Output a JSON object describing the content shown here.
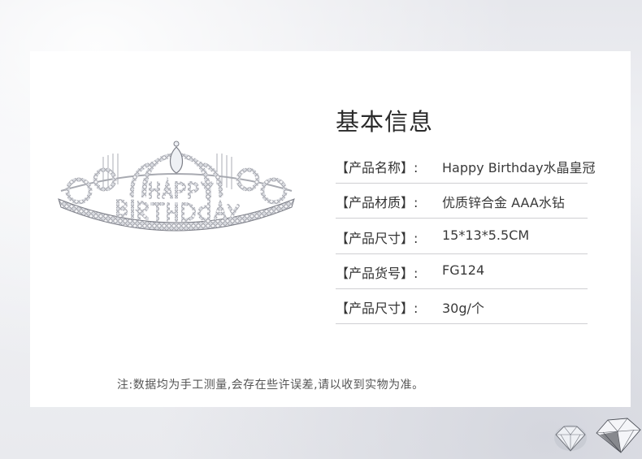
{
  "title": "基本信息",
  "rows": [
    {
      "label": "【产品名称】:",
      "value": "Happy Birthday水晶皇冠"
    },
    {
      "label": "【产品材质】:",
      "value": "优质锌合金 AAA水钻"
    },
    {
      "label": "【产品尺寸】:",
      "value": "15*13*5.5CM"
    },
    {
      "label": "【产品货号】:",
      "value": " FG124"
    },
    {
      "label": "【产品尺寸】:",
      "value": " 30g/个"
    }
  ],
  "note": "注:数据均为手工测量,会存在些许误差,请以收到实物为准。",
  "colors": {
    "card": "#ffffff",
    "background": "#e9eaee",
    "divider": "#cfcfd3",
    "text": "#333333"
  },
  "images": {
    "product": "crown-tiara-image",
    "decoration": "diamond-gems-image"
  }
}
